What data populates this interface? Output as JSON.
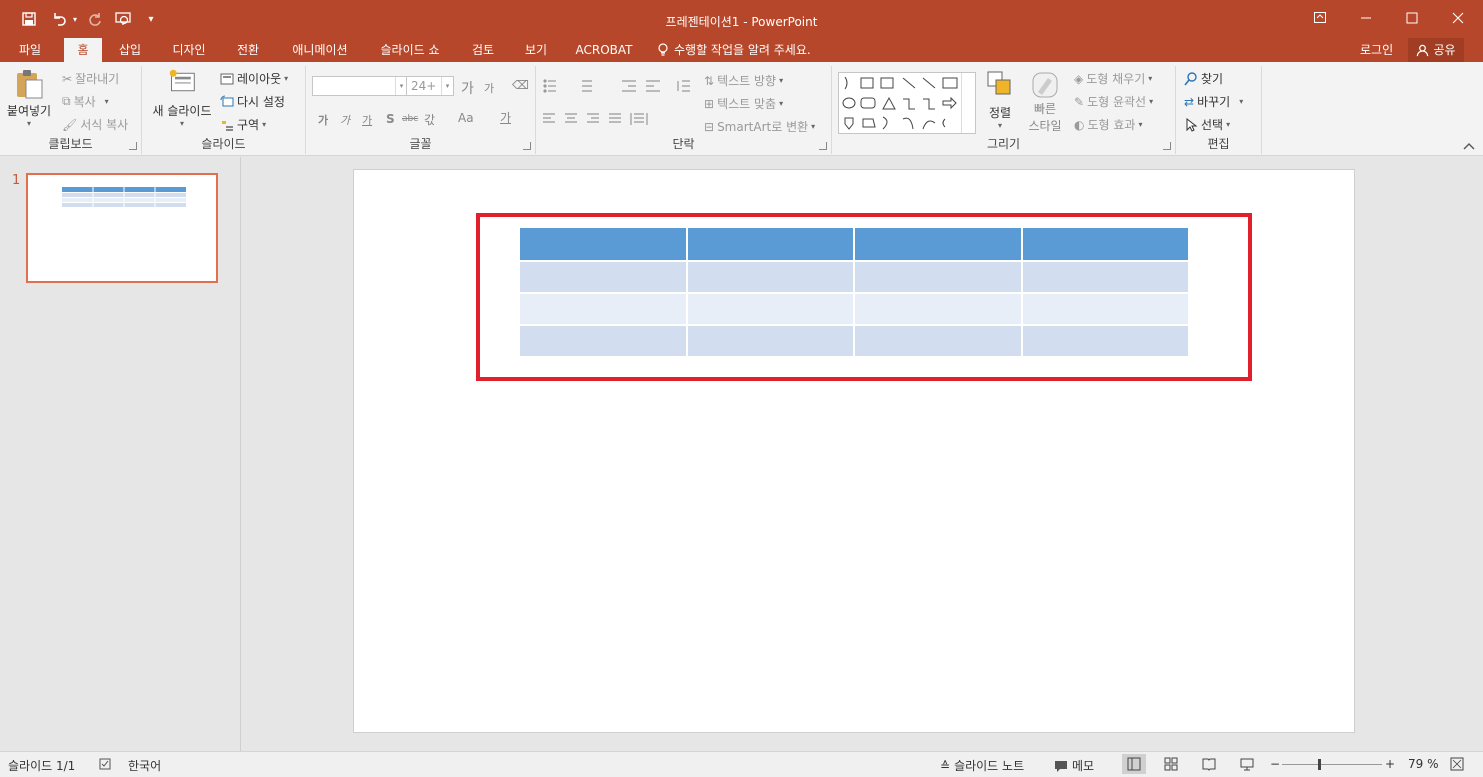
{
  "window": {
    "title": "프레젠테이션1 - PowerPoint",
    "accent_color": "#b7472a",
    "quick_access": [
      "save-icon",
      "undo-icon",
      "redo-icon",
      "start-from-beginning-icon",
      "customize-qat-icon"
    ]
  },
  "tabs": [
    {
      "label": "파일"
    },
    {
      "label": "홈",
      "active": true
    },
    {
      "label": "삽입"
    },
    {
      "label": "디자인"
    },
    {
      "label": "전환"
    },
    {
      "label": "애니메이션"
    },
    {
      "label": "슬라이드 쇼"
    },
    {
      "label": "검토"
    },
    {
      "label": "보기"
    },
    {
      "label": "ACROBAT"
    }
  ],
  "tell_me": "수행할 작업을 알려 주세요.",
  "account": {
    "login": "로그인",
    "share": "공유"
  },
  "ribbon": {
    "clipboard": {
      "label": "클립보드",
      "paste": "붙여넣기",
      "cut": "잘라내기",
      "copy": "복사",
      "format_painter": "서식 복사"
    },
    "slides": {
      "label": "슬라이드",
      "new_slide": "새 슬라이드",
      "layout": "레이아웃",
      "reset": "다시 설정",
      "section": "구역"
    },
    "font": {
      "label": "글꼴",
      "font_name": "",
      "font_size": "24+",
      "grow": "가",
      "shrink": "가",
      "bold": "가",
      "italic": "가",
      "underline": "가",
      "shadow": "S",
      "strike": "abc",
      "spacing": "갃",
      "case": "Aa",
      "color": "가"
    },
    "paragraph": {
      "label": "단락",
      "text_direction": "텍스트 방향",
      "align_text": "텍스트 맞춤",
      "smartart": "SmartArt로 변환"
    },
    "drawing": {
      "label": "그리기",
      "arrange": "정렬",
      "quick_styles_1": "빠른",
      "quick_styles_2": "스타일",
      "shape_fill": "도형 채우기",
      "shape_outline": "도형 윤곽선",
      "shape_effects": "도형 효과"
    },
    "editing": {
      "label": "편집",
      "find": "찾기",
      "replace": "바꾸기",
      "select": "선택"
    }
  },
  "thumbnails": [
    {
      "number": "1"
    }
  ],
  "slide": {
    "table": {
      "columns": 4,
      "rows": 4,
      "header_color": "#5b9bd5",
      "band_color_1": "#d2def0",
      "band_color_2": "#e8eef8"
    },
    "highlight_color": "#e0202a"
  },
  "status": {
    "slide_info": "슬라이드 1/1",
    "language": "한국어",
    "notes": "슬라이드 노트",
    "comments": "메모",
    "zoom": "79 %"
  }
}
